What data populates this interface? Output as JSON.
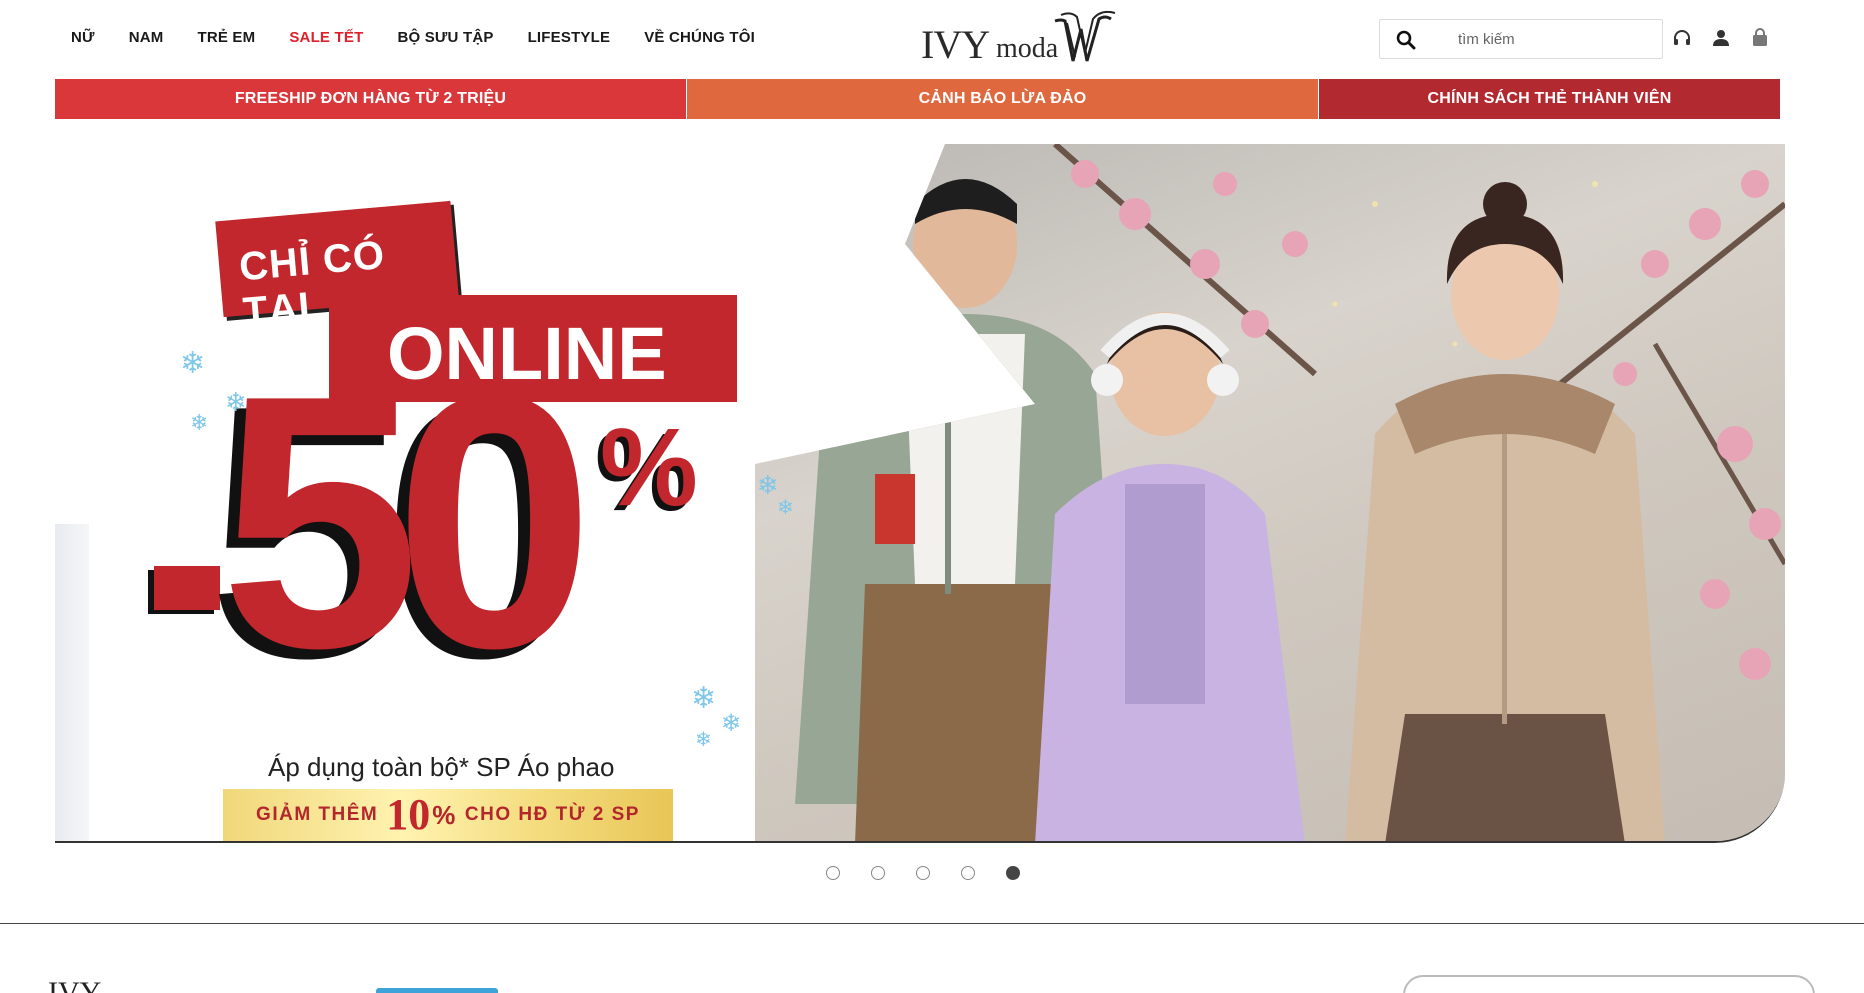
{
  "nav": {
    "items": [
      {
        "label": "NỮ"
      },
      {
        "label": "NAM"
      },
      {
        "label": "TRẺ EM"
      },
      {
        "label": "SALE TẾT"
      },
      {
        "label": "BỘ SƯU TẬP"
      },
      {
        "label": "LIFESTYLE"
      },
      {
        "label": "VỀ CHÚNG TÔI"
      }
    ]
  },
  "logo": {
    "ivy": "IVY",
    "moda": "moda"
  },
  "search": {
    "placeholder": "tìm kiếm",
    "icon": "search-icon"
  },
  "header_icons": [
    "headset-icon",
    "user-icon",
    "shopping-bag-icon"
  ],
  "promo": {
    "item1": "FREESHIP ĐƠN HÀNG TỪ 2 TRIỆU",
    "item2": "CẢNH BÁO LỪA ĐẢO",
    "item3": "CHÍNH SÁCH THẺ THÀNH VIÊN"
  },
  "banner": {
    "badge_top": "CHỈ CÓ TẠI",
    "badge_main": "ONLINE",
    "discount_num": "50",
    "discount_pct": "%",
    "applies_text": "Áp dụng toàn bộ* SP Áo phao",
    "extra_prefix": "GIẢM THÊM",
    "extra_value": "10",
    "extra_pct": "%",
    "extra_suffix": "CHO HĐ TỪ 2 SP"
  },
  "carousel": {
    "count": 5,
    "active_index": 5
  },
  "colors": {
    "sale": "#e0202a",
    "promo1": "#d9373a",
    "promo2": "#e0683e",
    "promo3": "#b22a30",
    "banner_red": "#c1272d"
  }
}
